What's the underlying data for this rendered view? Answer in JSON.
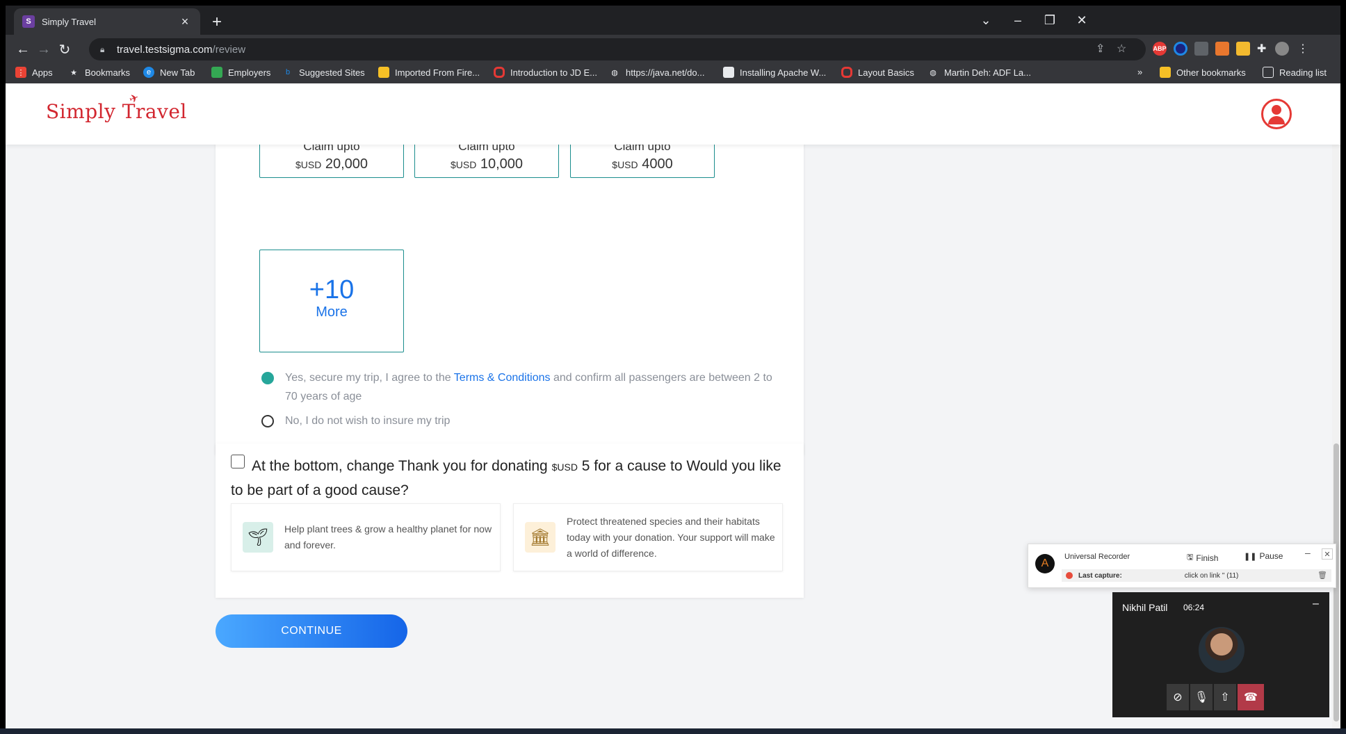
{
  "browser": {
    "tab_title": "Simply Travel",
    "tab_favicon": "S",
    "url_host": "travel.testsigma.com",
    "url_path": "/review",
    "new_tab_symbol": "+",
    "extensions": [
      "ABP",
      "",
      "",
      "",
      ""
    ],
    "bookmarks": [
      {
        "label": "Apps",
        "icon": "apps-grid-icon",
        "color": "#ea4335"
      },
      {
        "label": "Bookmarks",
        "icon": "star-icon",
        "color": "#9aa0a6"
      },
      {
        "label": "New Tab",
        "icon": "edge-icon",
        "color": "#1e88e5"
      },
      {
        "label": "Employers",
        "icon": "doc-icon",
        "color": "#34a853"
      },
      {
        "label": "Suggested Sites",
        "icon": "bing-icon",
        "color": "#1e88e5"
      },
      {
        "label": "Imported From Fire...",
        "icon": "folder-icon",
        "color": "#f6c026"
      },
      {
        "label": "Introduction to JD E...",
        "icon": "oracle-icon",
        "color": "#e53935"
      },
      {
        "label": "https://java.net/do...",
        "icon": "globe-icon",
        "color": "#9aa0a6"
      },
      {
        "label": "Installing Apache W...",
        "icon": "page-icon",
        "color": "#e8eaed"
      },
      {
        "label": "Layout Basics",
        "icon": "oracle-icon",
        "color": "#e53935"
      },
      {
        "label": "Martin Deh: ADF La...",
        "icon": "globe-icon",
        "color": "#9aa0a6"
      }
    ],
    "bookmarks_overflow": "»",
    "other_bookmarks": "Other bookmarks",
    "reading_list": "Reading list"
  },
  "site": {
    "logo_text": "Simply Travel"
  },
  "insurance": {
    "plans": [
      {
        "claim": "Claim upto",
        "currency": "$USD",
        "amount": "20,000"
      },
      {
        "claim": "Claim upto",
        "currency": "$USD",
        "amount": "10,000"
      },
      {
        "claim": "Claim upto",
        "currency": "$USD",
        "amount": "4000"
      }
    ],
    "more_count": "+10",
    "more_label": "More",
    "option_yes_prefix": "Yes, secure my trip, I agree to the ",
    "option_yes_link": "Terms & Conditions",
    "option_yes_suffix": " and confirm all passengers are between 2 to 70 years of age",
    "option_no": "No, I do not wish to insure my trip"
  },
  "donation": {
    "title_prefix": "At the bottom, change Thank you for donating ",
    "currency": "$USD",
    "title_suffix": " 5 for a cause to Would you like to be part of a good cause?",
    "causes": [
      {
        "text": "Help plant trees & grow a healthy planet for now and forever.",
        "icon": "plant-icon",
        "bg": "#d8efe9"
      },
      {
        "text": "Protect threatened species and their habitats today with your donation. Your support will make a world of difference.",
        "icon": "temple-icon",
        "bg": "#fdf0d9"
      }
    ]
  },
  "continue_label": "CONTINUE",
  "recorder": {
    "name": "Universal Recorder",
    "finish": "Finish",
    "pause": "Pause",
    "last_capture_label": "Last capture:",
    "last_capture_value": "click on link '' (11)"
  },
  "call": {
    "name": "Nikhil Patil",
    "time": "06:24"
  }
}
